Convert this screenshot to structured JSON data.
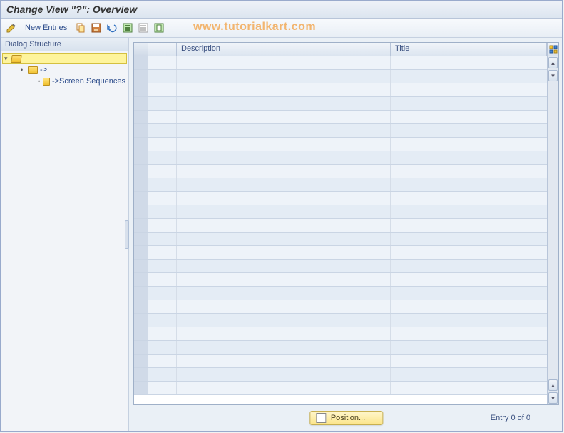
{
  "title": "Change View \"?\": Overview",
  "toolbar": {
    "new_entries_label": "New Entries"
  },
  "sidebar": {
    "header": "Dialog Structure",
    "items": [
      {
        "label": "",
        "indent": 0,
        "expanded": true,
        "selected": true
      },
      {
        "label": "->",
        "indent": 1,
        "expanded": false,
        "selected": false
      },
      {
        "label": "->Screen Sequences",
        "indent": 2,
        "expanded": false,
        "selected": false
      }
    ]
  },
  "table": {
    "columns": {
      "description": "Description",
      "title": "Title"
    },
    "rows": 25
  },
  "status": {
    "position_label": "Position...",
    "entry_count": "Entry 0 of 0"
  },
  "watermark": "www.tutorialkart.com"
}
